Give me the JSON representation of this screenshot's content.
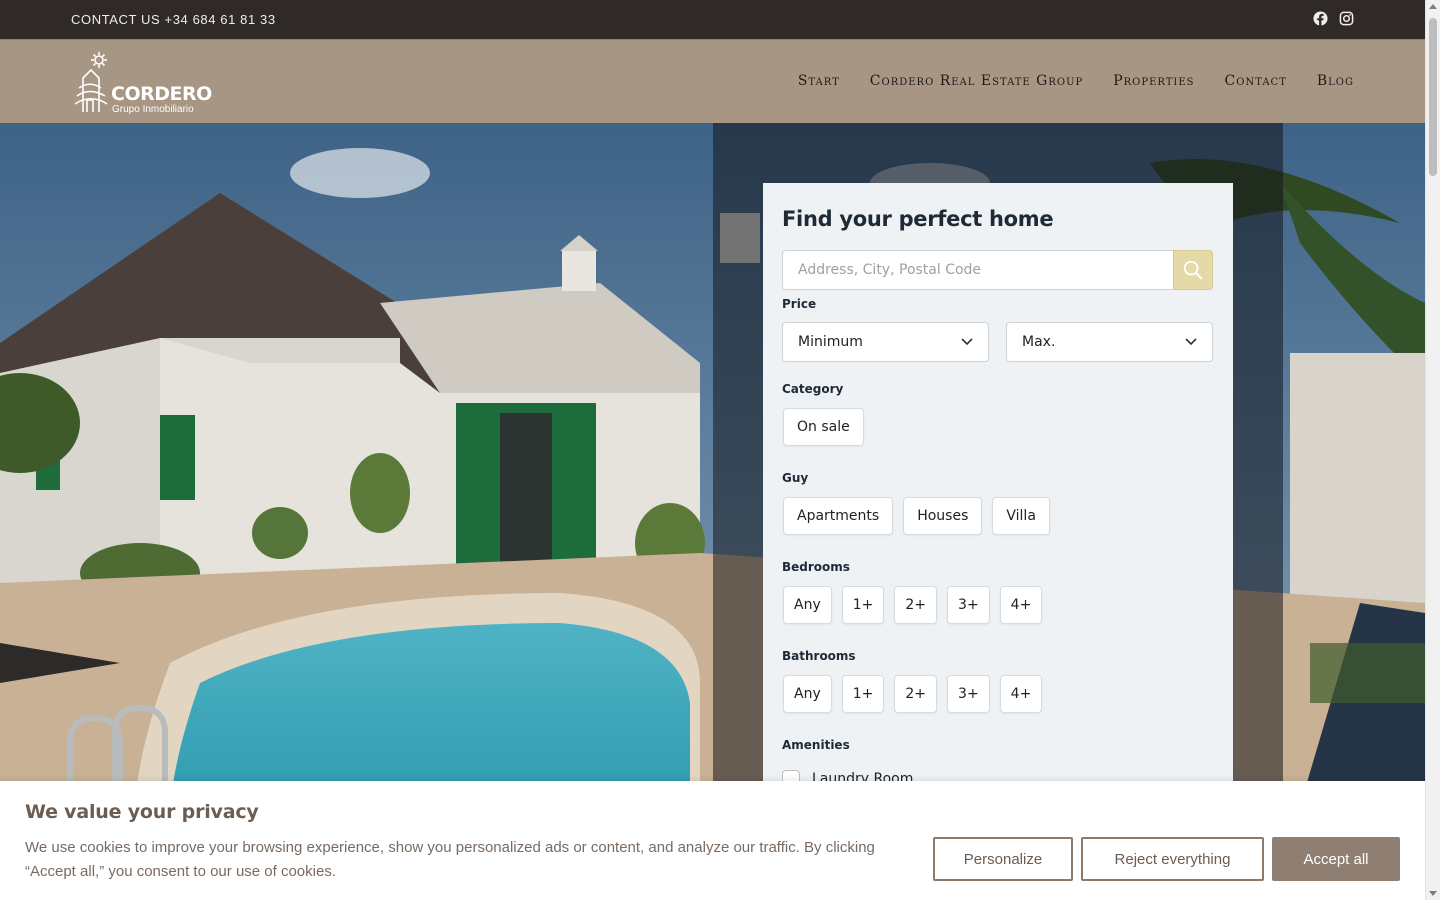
{
  "topbar": {
    "contact": "CONTACT US +34 684 61 81 33",
    "social_icons": [
      "facebook-icon",
      "instagram-icon"
    ]
  },
  "header": {
    "logo": {
      "brand": "CORDERO",
      "subtitle": "Grupo Inmobiliario"
    },
    "nav": [
      "Start",
      "Cordero Real Estate Group",
      "Properties",
      "Contact",
      "Blog"
    ]
  },
  "search": {
    "title": "Find your perfect home",
    "placeholder": "Address, City, Postal Code",
    "price_label": "Price",
    "price_min": "Minimum",
    "price_max": "Max.",
    "category_label": "Category",
    "categories": [
      "On sale"
    ],
    "type_label": "Guy",
    "types": [
      "Apartments",
      "Houses",
      "Villa"
    ],
    "bedrooms_label": "Bedrooms",
    "bedrooms": [
      "Any",
      "1+",
      "2+",
      "3+",
      "4+"
    ],
    "bathrooms_label": "Bathrooms",
    "bathrooms": [
      "Any",
      "1+",
      "2+",
      "3+",
      "4+"
    ],
    "amenities_label": "Amenities",
    "amenities": [
      "Laundry Room"
    ]
  },
  "cookie": {
    "title": "We value your privacy",
    "text": "We use cookies to improve your browsing experience, show you personalized ads or content, and analyze our traffic. By clicking “Accept all,” you consent to our use of cookies.",
    "personalize": "Personalize",
    "reject": "Reject everything",
    "accept": "Accept all"
  },
  "colors": {
    "topbar": "#2f2a28",
    "header": "#a69683",
    "search_button": "#e6d9a8",
    "accept_button": "#8e7f72"
  }
}
